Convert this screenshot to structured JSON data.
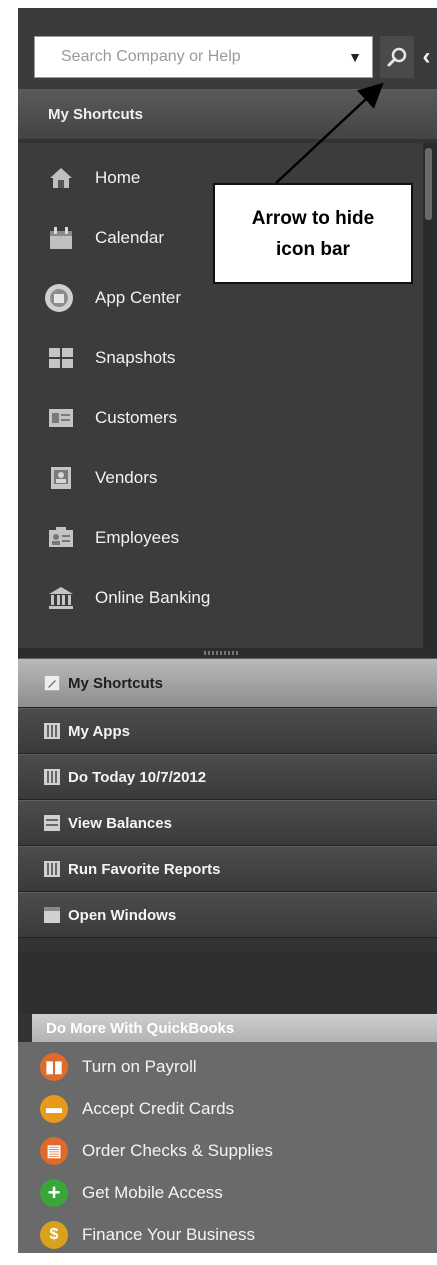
{
  "search": {
    "placeholder": "Search Company or Help"
  },
  "shortcuts_header": "My Shortcuts",
  "shortcuts": [
    {
      "label": "Home",
      "icon": "home-icon"
    },
    {
      "label": "Calendar",
      "icon": "calendar-icon"
    },
    {
      "label": "App Center",
      "icon": "app-center-icon"
    },
    {
      "label": "Snapshots",
      "icon": "snapshots-icon"
    },
    {
      "label": "Customers",
      "icon": "customers-icon"
    },
    {
      "label": "Vendors",
      "icon": "vendors-icon"
    },
    {
      "label": "Employees",
      "icon": "employees-icon"
    },
    {
      "label": "Online Banking",
      "icon": "bank-icon"
    }
  ],
  "nav_tabs": [
    {
      "label": "My Shortcuts",
      "active": true
    },
    {
      "label": "My Apps"
    },
    {
      "label": "Do Today 10/7/2012"
    },
    {
      "label": "View Balances"
    },
    {
      "label": "Run Favorite Reports"
    },
    {
      "label": "Open Windows"
    }
  ],
  "do_more": {
    "header": "Do More With QuickBooks",
    "items": [
      {
        "label": "Turn on Payroll",
        "icon": "payroll-icon",
        "color": "#e06a2a"
      },
      {
        "label": "Accept Credit Cards",
        "icon": "credit-card-icon",
        "color": "#e89a1c"
      },
      {
        "label": "Order Checks & Supplies",
        "icon": "checks-icon",
        "color": "#e06a2a"
      },
      {
        "label": "Get Mobile Access",
        "icon": "plus-icon",
        "color": "#3aa53a"
      },
      {
        "label": "Finance Your Business",
        "icon": "finance-icon",
        "color": "#d8a21c"
      }
    ]
  },
  "annotation": {
    "line1": "Arrow to hide",
    "line2": "icon bar"
  }
}
